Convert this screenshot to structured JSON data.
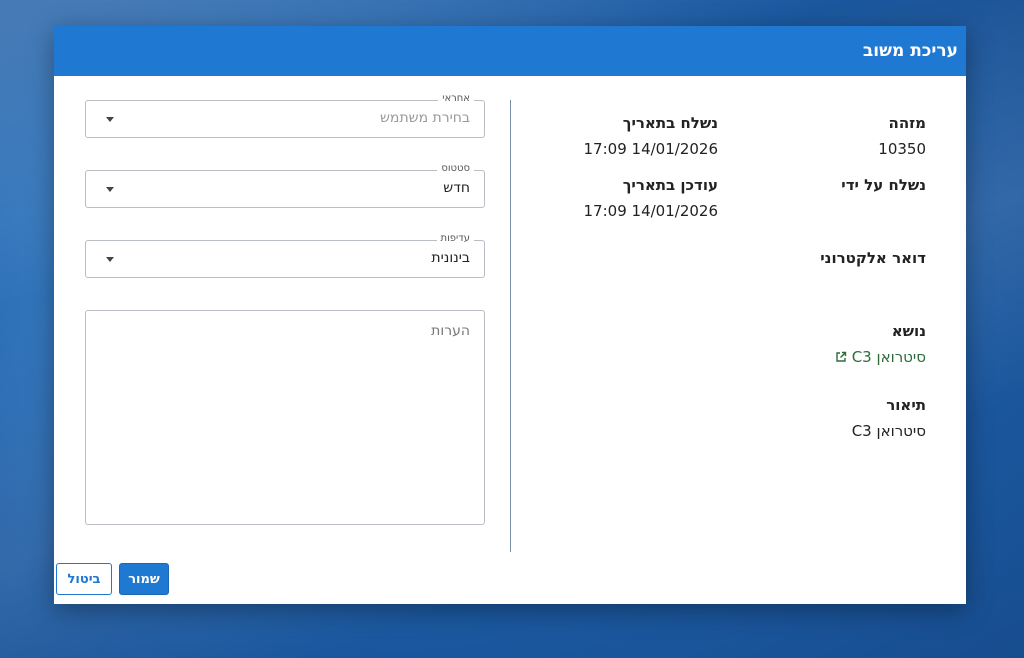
{
  "dialog": {
    "title": "עריכת משוב"
  },
  "details": {
    "id": {
      "label": "מזהה",
      "value": "10350"
    },
    "sent_date": {
      "label": "נשלח בתאריך",
      "value": "14/01/2026 17:09"
    },
    "sent_by": {
      "label": "נשלח על ידי",
      "value": ""
    },
    "updated_date": {
      "label": "עודכן בתאריך",
      "value": "14/01/2026 17:09"
    },
    "email": {
      "label": "דואר אלקטרוני",
      "value": ""
    },
    "subject": {
      "label": "נושא",
      "value": "סיטרואן C3",
      "icon": "external-link-icon"
    },
    "description": {
      "label": "תיאור",
      "value": "סיטרואן C3"
    }
  },
  "form": {
    "assignee": {
      "legend": "אחראי",
      "placeholder": "בחירת משתמש"
    },
    "status": {
      "legend": "סטטוס",
      "value": "חדש"
    },
    "priority": {
      "legend": "עדיפות",
      "value": "בינונית"
    },
    "notes": {
      "placeholder": "הערות"
    }
  },
  "actions": {
    "save_label": "שמור",
    "cancel_label": "ביטול"
  },
  "colors": {
    "primary": "#1f78d1",
    "link": "#2e6b3c"
  }
}
